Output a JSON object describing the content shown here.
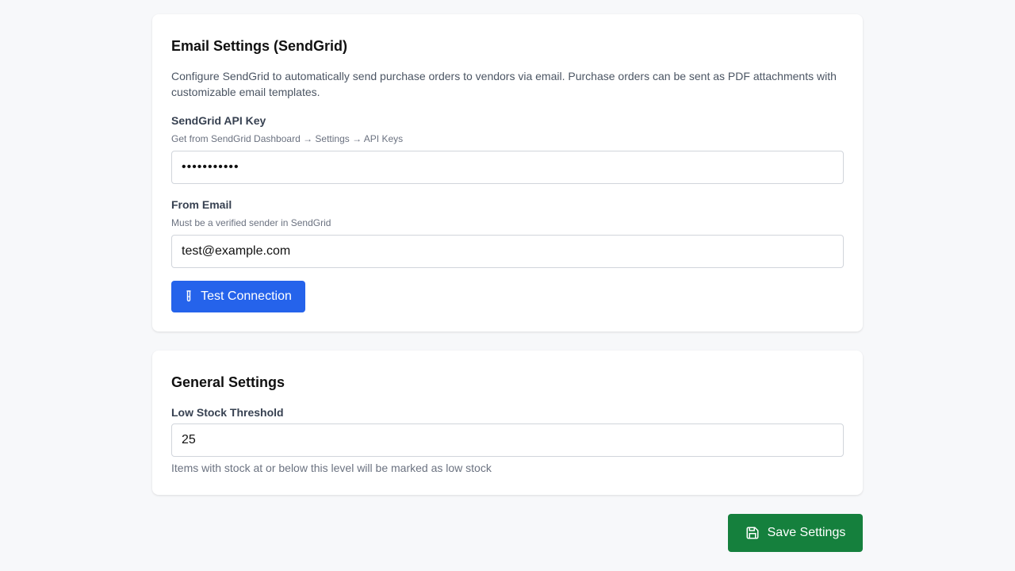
{
  "email_section": {
    "title": "Email Settings (SendGrid)",
    "description": "Configure SendGrid to automatically send purchase orders to vendors via email. Purchase orders can be sent as PDF attachments with customizable email templates.",
    "api_key": {
      "label": "SendGrid API Key",
      "hint": "Get from SendGrid Dashboard → Settings → API Keys",
      "value": "•••••••••••"
    },
    "from_email": {
      "label": "From Email",
      "hint": "Must be a verified sender in SendGrid",
      "value": "test@example.com"
    },
    "test_button": {
      "label": "Test Connection",
      "icon": "test-tube-icon",
      "color": "#2563eb"
    }
  },
  "general_section": {
    "title": "General Settings",
    "low_stock": {
      "label": "Low Stock Threshold",
      "value": "25",
      "hint": "Items with stock at or below this level will be marked as low stock"
    }
  },
  "save_button": {
    "label": "Save Settings",
    "icon": "save-icon",
    "color": "#15803d"
  },
  "colors": {
    "background": "#f7f8fa",
    "card": "#ffffff",
    "border": "#d1d5db"
  }
}
